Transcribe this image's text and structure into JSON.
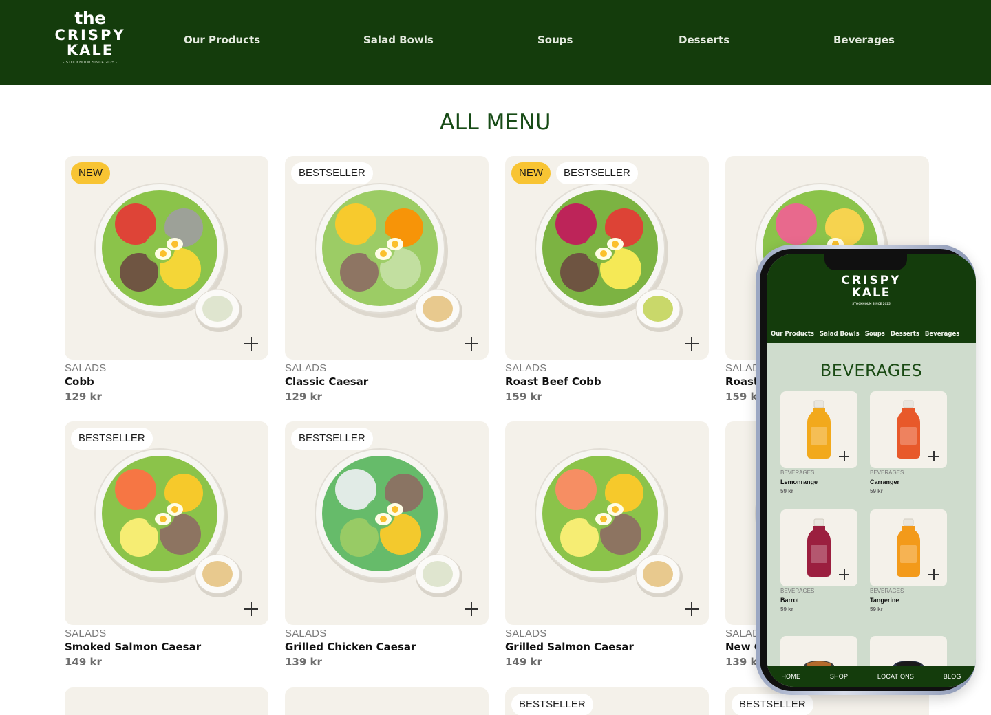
{
  "header": {
    "logo": {
      "line0": "the",
      "line1": "CRISPY",
      "line2": "KALE",
      "tagline": "- STOCKHOLM SINCE 2025 -"
    },
    "nav": [
      "Our Products",
      "Salad Bowls",
      "Soups",
      "Desserts",
      "Beverages"
    ]
  },
  "main": {
    "title": "ALL MENU",
    "products": [
      {
        "category": "SALADS",
        "name": "Cobb",
        "price": "129 kr",
        "badges": [
          "NEW"
        ]
      },
      {
        "category": "SALADS",
        "name": "Classic Caesar",
        "price": "129 kr",
        "badges": [
          "BESTSELLER"
        ]
      },
      {
        "category": "SALADS",
        "name": "Roast Beef Cobb",
        "price": "159 kr",
        "badges": [
          "NEW",
          "BESTSELLER"
        ]
      },
      {
        "category": "SALADS",
        "name": "Roast Beef Caesar",
        "price": "159 kr",
        "badges": []
      },
      {
        "category": "SALADS",
        "name": "Smoked Salmon Caesar",
        "price": "149 kr",
        "badges": [
          "BESTSELLER"
        ]
      },
      {
        "category": "SALADS",
        "name": "Grilled Chicken Caesar",
        "price": "139 kr",
        "badges": [
          "BESTSELLER"
        ]
      },
      {
        "category": "SALADS",
        "name": "Grilled Salmon Caesar",
        "price": "149 kr",
        "badges": []
      },
      {
        "category": "SALADS",
        "name": "New Caesar",
        "price": "139 kr",
        "badges": []
      }
    ],
    "partial_row_badges": [
      "BESTSELLER",
      "BESTSELLER"
    ]
  },
  "mobile": {
    "logo": {
      "line1": "CRISPY",
      "line2": "KALE",
      "tagline": "STOCKHOLM SINCE 2025"
    },
    "nav": [
      "Our Products",
      "Salad Bowls",
      "Soups",
      "Desserts",
      "Beverages"
    ],
    "title": "BEVERAGES",
    "products": [
      {
        "category": "BEVERAGES",
        "name": "Lemonrange",
        "price": "59 kr",
        "color": "#f2a91c"
      },
      {
        "category": "BEVERAGES",
        "name": "Carranger",
        "price": "59 kr",
        "color": "#e8592a"
      },
      {
        "category": "BEVERAGES",
        "name": "Barrot",
        "price": "59 kr",
        "color": "#9b1f3f"
      },
      {
        "category": "BEVERAGES",
        "name": "Tangerine",
        "price": "59 kr",
        "color": "#f39a1a"
      }
    ],
    "bottom_nav": [
      "HOME",
      "SHOP",
      "LOCATIONS",
      "BLOG"
    ]
  },
  "colors": {
    "brand_green": "#143c0c",
    "title_green": "#174b16",
    "badge_new": "#f8c433",
    "card_bg": "#f4f1ea",
    "mobile_bg": "#cfdccd"
  }
}
